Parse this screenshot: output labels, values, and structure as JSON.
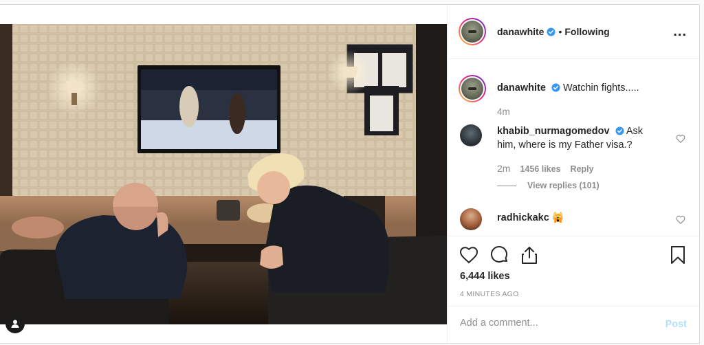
{
  "header": {
    "username": "danawhite",
    "separator": "•",
    "follow_status": "Following",
    "more_label": "..."
  },
  "caption": {
    "username": "danawhite",
    "text": "Watchin fights.....",
    "time": "4m"
  },
  "comments": [
    {
      "username": "khabib_nurmagomedov",
      "text": "Ask him, where is my Father visa.?",
      "time": "2m",
      "likes": "1456 likes",
      "reply_label": "Reply",
      "view_replies": "View replies (101)"
    },
    {
      "username": "radhickakc",
      "text": "🙀"
    }
  ],
  "actions": {
    "like_icon": "heart-icon",
    "comment_icon": "comment-icon",
    "share_icon": "share-icon",
    "save_icon": "bookmark-icon"
  },
  "stats": {
    "likes": "6,444 likes",
    "posted": "4 MINUTES AGO"
  },
  "add_comment": {
    "placeholder": "Add a comment...",
    "post_label": "Post"
  },
  "colors": {
    "verified_blue": "#3897f0",
    "post_disabled": "#b2dffc",
    "muted": "#8e8e8e"
  }
}
